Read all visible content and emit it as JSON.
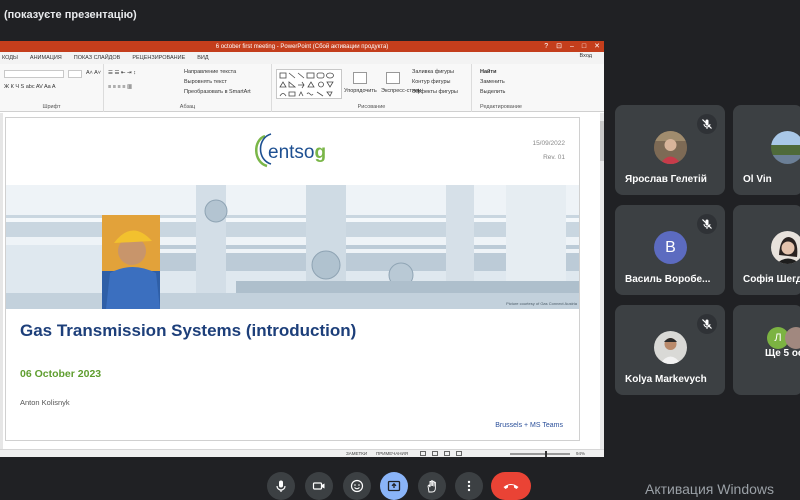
{
  "window": {
    "title": "(показуєте презентацію)"
  },
  "powerpoint": {
    "title": "6 october first meeting  -  PowerPoint (Сбой активации продукта)",
    "win_controls": [
      "?",
      "⊡",
      "–",
      "□",
      "✕"
    ],
    "tabs": [
      "КОДЫ",
      "АНИМАЦИЯ",
      "ПОКАЗ СЛАЙДОВ",
      "РЕЦЕНЗИРОВАНИЕ",
      "ВИД"
    ],
    "login": "Вход",
    "ribbon": {
      "group_font": "Шрифт",
      "group_paragraph": "Абзац",
      "group_drawing": "Рисование",
      "group_editing": "Редактирование",
      "text_direction": "Направление текста",
      "align_text": "Выровнять текст",
      "convert_smartart": "Преобразовать в SmartArt",
      "arrange": "Упорядочить",
      "quick_styles": "Экспресс-стили",
      "shape_fill": "Заливка фигуры",
      "shape_outline": "Контур фигуры",
      "shape_effects": "Эффекты фигуры",
      "find": "Найти",
      "replace": "Заменить",
      "select": "Выделить"
    },
    "slide": {
      "logo_text": "entsog",
      "date": "15/09/2022",
      "rev": "Rev. 01",
      "photo_credit": "Picture courtesy of Gas Connect Austria",
      "title": "Gas Transmission Systems (introduction)",
      "date2": "06 October 2023",
      "author": "Anton Kolisnyk",
      "footer": "Brussels + MS Teams"
    },
    "status": {
      "notes": "ЗАМЕТКИ",
      "comments": "ПРИМЕЧАНИЯ",
      "zoom": "94%"
    }
  },
  "participants": [
    {
      "name": "Ярослав Гелетій",
      "muted": true,
      "avatar": "photo-bookshelf"
    },
    {
      "name": "Ol Vin",
      "muted": false,
      "avatar": "photo-landscape"
    },
    {
      "name": "Василь Воробе...",
      "muted": true,
      "avatar": "В",
      "avatar_color": "#5c6bc0"
    },
    {
      "name": "Софія Шегд",
      "muted": false,
      "avatar": "photo-portrait"
    },
    {
      "name": "Kolya Markevych",
      "muted": true,
      "avatar": "photo-person"
    },
    {
      "name": "Ще 5 ос",
      "muted": false,
      "avatar": "Л",
      "avatar_color": "#7cb342"
    }
  ],
  "controls": [
    "mic-icon",
    "camera-icon",
    "emoji-icon",
    "present-icon",
    "raise-hand-icon",
    "more-icon",
    "leave-call-icon"
  ],
  "activation_text": "Активация Windows"
}
